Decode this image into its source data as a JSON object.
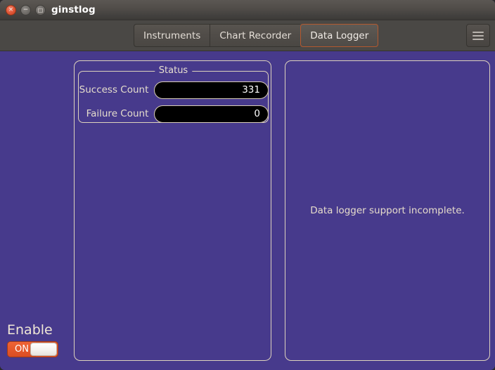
{
  "window": {
    "title": "ginstlog",
    "controls": {
      "close": "×",
      "minimize": "−",
      "maximize": "□"
    }
  },
  "toolbar": {
    "tabs": [
      {
        "label": "Instruments",
        "active": false
      },
      {
        "label": "Chart Recorder",
        "active": false
      },
      {
        "label": "Data Logger",
        "active": true
      }
    ],
    "menu_button": "menu-icon"
  },
  "left_panel": {
    "status_group": {
      "legend": "Status",
      "fields": [
        {
          "label": "Success Count",
          "value": "331"
        },
        {
          "label": "Failure Count",
          "value": "0"
        }
      ]
    }
  },
  "right_panel": {
    "message": "Data logger support incomplete."
  },
  "enable": {
    "label": "Enable",
    "state_label": "ON",
    "checked": true
  },
  "colors": {
    "window_background": "#473a8c",
    "toolbar_background": "#4a4845",
    "titlebar_top": "#5b5753",
    "titlebar_bottom": "#3c3a37",
    "panel_border": "#ded3bd",
    "text_light": "#e5ddcc",
    "accent_orange": "#e4572a",
    "active_tab_border": "#b4592f",
    "field_background": "#000000"
  }
}
